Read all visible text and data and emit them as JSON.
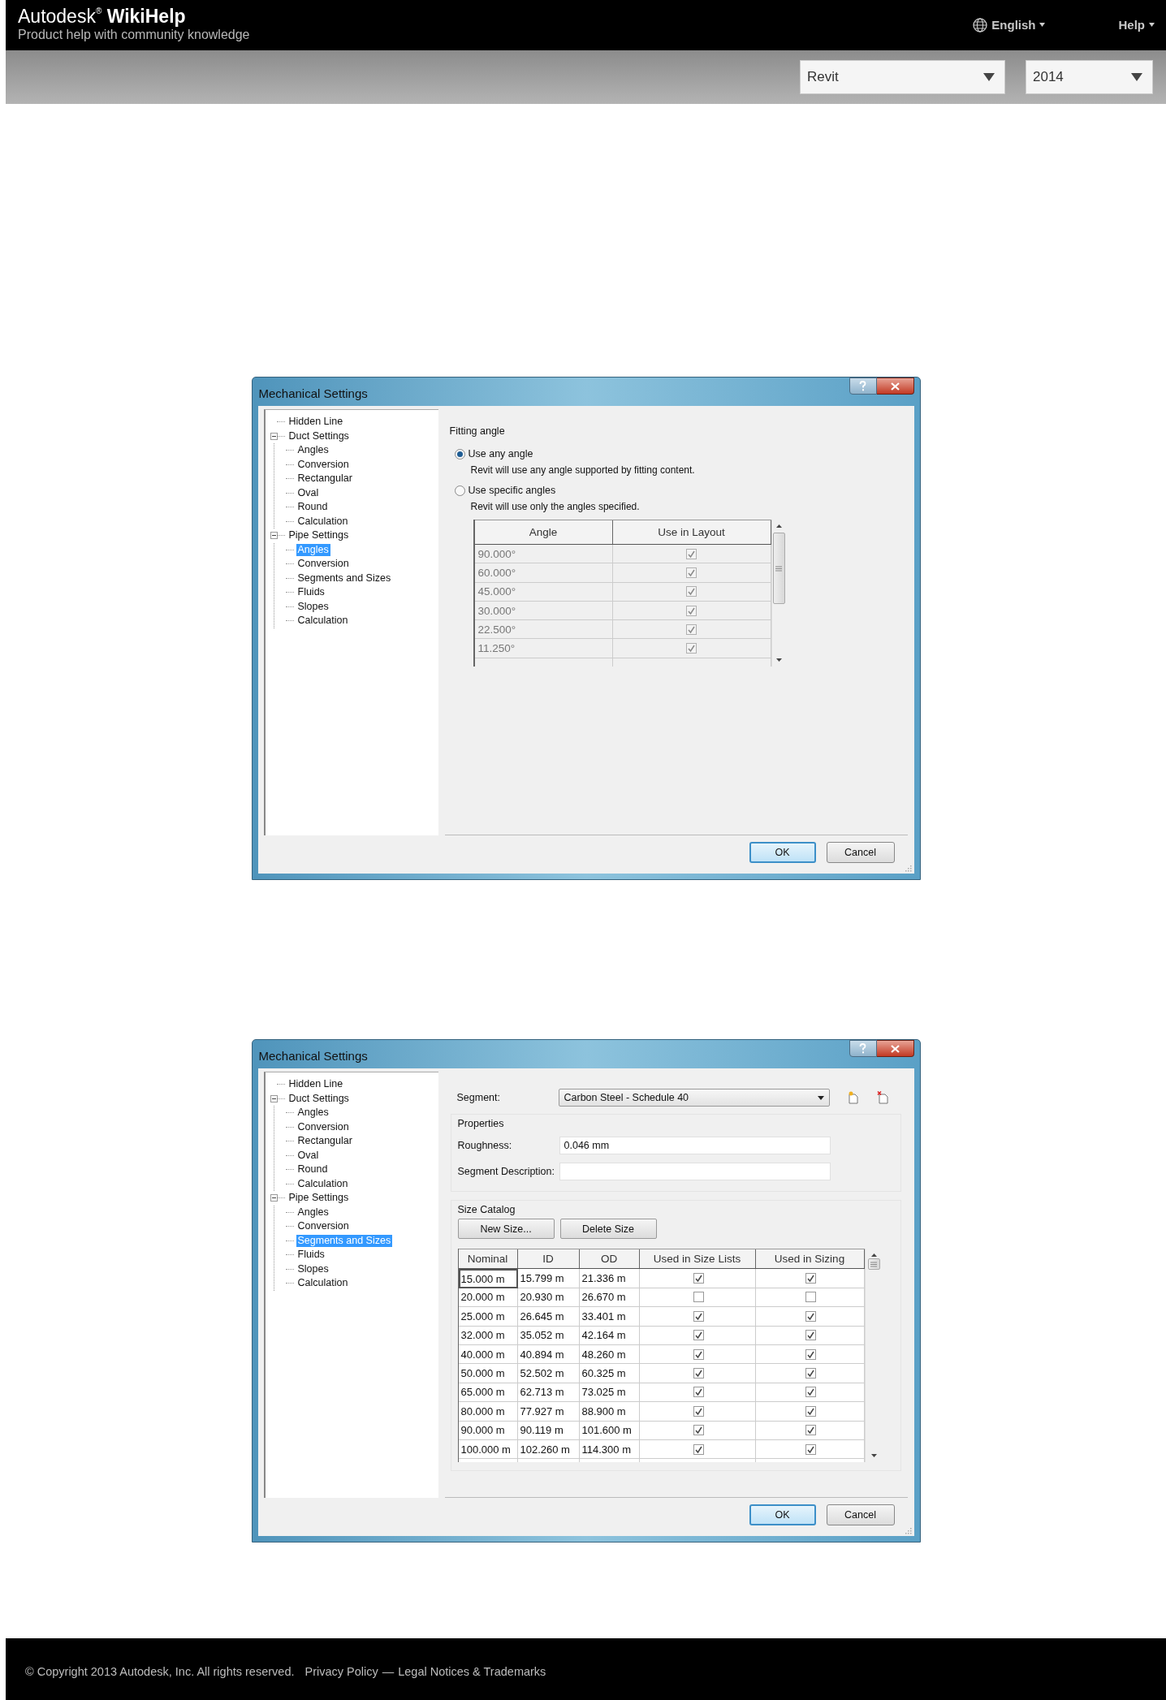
{
  "header": {
    "logo": "Autodesk$^{®}$ **WikiHelp**",
    "tagline": "Product help with community knowledge",
    "language": "English",
    "help": "Help"
  },
  "selectors": [
    {
      "kind": "product",
      "value": "Revit"
    },
    {
      "kind": "version",
      "value": "2014"
    }
  ],
  "dialogs": [
    {
      "kind": "angles",
      "title": "Mechanical Settings",
      "tree": [
        {
          "label": "Hidden Line",
          "selected": false
        },
        {
          "label": "Duct Settings",
          "selected": false,
          "expanded": true,
          "children": [
            {
              "label": "Angles",
              "selected": false
            },
            {
              "label": "Conversion",
              "selected": false
            },
            {
              "label": "Rectangular",
              "selected": false
            },
            {
              "label": "Oval",
              "selected": false
            },
            {
              "label": "Round",
              "selected": false
            },
            {
              "label": "Calculation",
              "selected": false
            }
          ]
        },
        {
          "label": "Pipe Settings",
          "selected": false,
          "expanded": true,
          "children": [
            {
              "label": "Angles",
              "selected": true
            },
            {
              "label": "Conversion",
              "selected": false
            },
            {
              "label": "Segments and Sizes",
              "selected": false
            },
            {
              "label": "Fluids",
              "selected": false
            },
            {
              "label": "Slopes",
              "selected": false
            },
            {
              "label": "Calculation",
              "selected": false
            }
          ]
        }
      ],
      "panel": {
        "group_label": "Fitting angle",
        "options": [
          {
            "label": "Use any angle",
            "selected": true,
            "description": "Revit will use any angle supported by fitting content."
          },
          {
            "label": "Use specific angles",
            "selected": false,
            "description": "Revit will use only the angles specified."
          }
        ],
        "table": {
          "disabled": true,
          "columns": [
            "Angle",
            "Use in Layout"
          ],
          "rows": [
            {
              "angle": "90.000°",
              "use_in_layout": true
            },
            {
              "angle": "60.000°",
              "use_in_layout": true
            },
            {
              "angle": "45.000°",
              "use_in_layout": true
            },
            {
              "angle": "30.000°",
              "use_in_layout": true
            },
            {
              "angle": "22.500°",
              "use_in_layout": true
            },
            {
              "angle": "11.250°",
              "use_in_layout": true
            }
          ]
        }
      },
      "buttons": [
        {
          "label": "OK",
          "default": true
        },
        {
          "label": "Cancel",
          "default": false
        }
      ]
    },
    {
      "kind": "segments",
      "title": "Mechanical Settings",
      "tree": [
        {
          "label": "Hidden Line",
          "selected": false
        },
        {
          "label": "Duct Settings",
          "selected": false,
          "expanded": true,
          "children": [
            {
              "label": "Angles",
              "selected": false
            },
            {
              "label": "Conversion",
              "selected": false
            },
            {
              "label": "Rectangular",
              "selected": false
            },
            {
              "label": "Oval",
              "selected": false
            },
            {
              "label": "Round",
              "selected": false
            },
            {
              "label": "Calculation",
              "selected": false
            }
          ]
        },
        {
          "label": "Pipe Settings",
          "selected": false,
          "expanded": true,
          "children": [
            {
              "label": "Angles",
              "selected": false
            },
            {
              "label": "Conversion",
              "selected": false
            },
            {
              "label": "Segments and Sizes",
              "selected": true
            },
            {
              "label": "Fluids",
              "selected": false
            },
            {
              "label": "Slopes",
              "selected": false
            },
            {
              "label": "Calculation",
              "selected": false
            }
          ]
        }
      ],
      "panel": {
        "segment": {
          "label": "Segment:",
          "value": "Carbon Steel - Schedule 40"
        },
        "properties": {
          "title": "Properties",
          "fields": [
            {
              "label": "Roughness:",
              "value": "0.046 mm"
            },
            {
              "label": "Segment Description:"
            }
          ]
        },
        "size_catalog": {
          "title": "Size Catalog",
          "buttons": [
            "New Size...",
            "Delete Size"
          ],
          "columns": [
            "Nominal",
            "ID",
            "OD",
            "Used in Size Lists",
            "Used in Sizing"
          ],
          "rows": [
            {
              "nominal": "15.000 m",
              "id": "15.799 m",
              "od": "21.336 m",
              "used_in_size_lists": true,
              "used_in_sizing": true,
              "focused": true
            },
            {
              "nominal": "20.000 m",
              "id": "20.930 m",
              "od": "26.670 m",
              "used_in_size_lists": false,
              "used_in_sizing": false,
              "focused": false
            },
            {
              "nominal": "25.000 m",
              "id": "26.645 m",
              "od": "33.401 m",
              "used_in_size_lists": true,
              "used_in_sizing": true,
              "focused": false
            },
            {
              "nominal": "32.000 m",
              "id": "35.052 m",
              "od": "42.164 m",
              "used_in_size_lists": true,
              "used_in_sizing": true,
              "focused": false
            },
            {
              "nominal": "40.000 m",
              "id": "40.894 m",
              "od": "48.260 m",
              "used_in_size_lists": true,
              "used_in_sizing": true,
              "focused": false
            },
            {
              "nominal": "50.000 m",
              "id": "52.502 m",
              "od": "60.325 m",
              "used_in_size_lists": true,
              "used_in_sizing": true,
              "focused": false
            },
            {
              "nominal": "65.000 m",
              "id": "62.713 m",
              "od": "73.025 m",
              "used_in_size_lists": true,
              "used_in_sizing": true,
              "focused": false
            },
            {
              "nominal": "80.000 m",
              "id": "77.927 m",
              "od": "88.900 m",
              "used_in_size_lists": true,
              "used_in_sizing": true,
              "focused": false
            },
            {
              "nominal": "90.000 m",
              "id": "90.119 m",
              "od": "101.600 m",
              "used_in_size_lists": true,
              "used_in_sizing": true,
              "focused": false
            },
            {
              "nominal": "100.000 m",
              "id": "102.260 m",
              "od": "114.300 m",
              "used_in_size_lists": true,
              "used_in_sizing": true,
              "focused": false
            }
          ]
        }
      },
      "buttons": [
        {
          "label": "OK",
          "default": true
        },
        {
          "label": "Cancel",
          "default": false
        }
      ]
    }
  ],
  "footer": {
    "copyright": "© Copyright 2013 Autodesk, Inc. All rights reserved.",
    "links": [
      {
        "label": "Privacy Policy"
      },
      {
        "label": "Legal Notices & Trademarks"
      }
    ],
    "separator": "—"
  }
}
